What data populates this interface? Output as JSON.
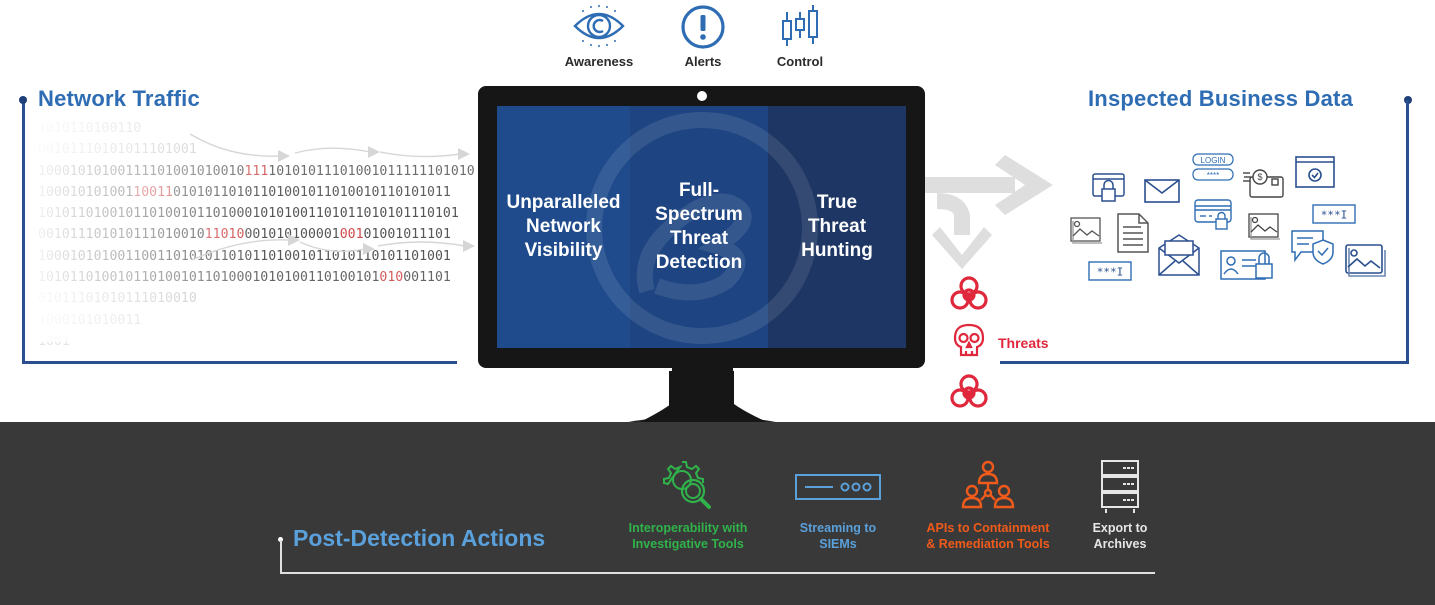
{
  "indicators": [
    {
      "label": "Awareness",
      "icon": "eye-icon"
    },
    {
      "label": "Alerts",
      "icon": "exclamation-icon"
    },
    {
      "label": "Control",
      "icon": "candlestick-icon"
    }
  ],
  "left_section": {
    "title": "Network Traffic",
    "binary_rows": [
      "1010110100110",
      "00101110101011101001",
      "1000101010011110100101001011110101011101001011111101010",
      "1000101010011001101010110101101001011010010110101011",
      "10101101001011010010110100010101001101011010101110101",
      "0010111010101110100101101000101010000100101001011101",
      "1000101010011001101010110101101001011010110101101001",
      "1010110100101101001011010001010100110100101010001101",
      "01011101010111010010",
      "1000101010011",
      "1001"
    ]
  },
  "monitor": {
    "panes": [
      {
        "text": "Unparalleled\nNetwork\nVisibility"
      },
      {
        "text": "Full-\nSpectrum\nThreat\nDetection"
      },
      {
        "text": "True\nThreat\nHunting"
      }
    ]
  },
  "threats": {
    "label": "Threats",
    "icons": [
      "biohazard-icon",
      "skull-icon",
      "biohazard-icon"
    ]
  },
  "right_section": {
    "title": "Inspected Business Data",
    "icons": [
      "browser-lock-icon",
      "envelope-icon",
      "login-form-icon",
      "payment-card-icon",
      "browser-check-icon",
      "image-icon",
      "document-icon",
      "credit-card-lock-icon",
      "password-field-icon",
      "image-icon",
      "open-envelope-icon",
      "id-card-lock-icon",
      "chat-shield-icon",
      "password-field-icon",
      "image-icon"
    ],
    "login_label": "LOGIN",
    "password_mask": "****",
    "password_field": "***I"
  },
  "bottom": {
    "title": "Post-Detection Actions",
    "actions": [
      {
        "label": "Interoperability with\nInvestigative Tools",
        "color": "#2fb34a",
        "icon": "gear-search-icon"
      },
      {
        "label": "Streaming to\nSIEMs",
        "color": "#5aa0db",
        "icon": "server-rack-icon"
      },
      {
        "label": "APIs to Containment\n& Remediation Tools",
        "color": "#f05a1a",
        "icon": "people-network-icon"
      },
      {
        "label": "Export to\nArchives",
        "color": "#e6e6e6",
        "icon": "server-stack-icon"
      }
    ]
  },
  "colors": {
    "brand_blue": "#2e6db4",
    "frame_blue": "#2a4f8f",
    "threat_red": "#e0283c",
    "band_gray": "#393939"
  }
}
